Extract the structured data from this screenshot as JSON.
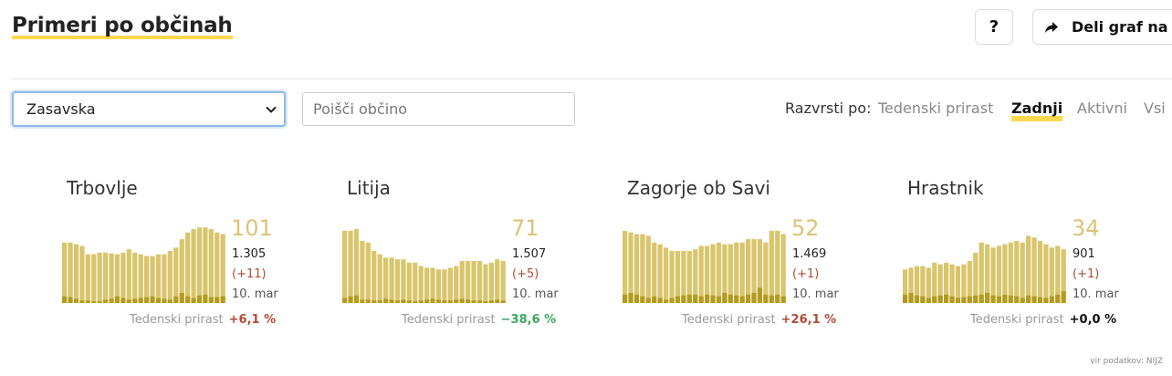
{
  "header": {
    "title": "Primeri po občinah",
    "help_label": "?",
    "share_label": "Deli graf na"
  },
  "filters": {
    "region_selected": "Zasavska",
    "search_placeholder": "Poišči občino",
    "sort_label": "Razvrsti po:",
    "sort_options": [
      "Tedenski prirast",
      "Zadnji",
      "Aktivni",
      "Vsi"
    ],
    "sort_active": "Zadnji"
  },
  "colors": {
    "bar_main": "#d9c56b",
    "bar_low": "#b39b1f",
    "big_number": "#dcc277",
    "negative_trend": "#b04a36",
    "positive_trend": "#3aa85d",
    "accent_underline": "#ffd84d"
  },
  "cards": [
    {
      "name": "Trbovlje",
      "active": "101",
      "total": "1.305",
      "delta": "(+11)",
      "date": "10. mar",
      "weekly_label": "Tedenski prirast",
      "weekly_value": "+6,1 %",
      "weekly_color": "#b04a36",
      "active_series": [
        72,
        72,
        70,
        68,
        58,
        58,
        60,
        60,
        59,
        58,
        60,
        64,
        60,
        58,
        56,
        56,
        58,
        58,
        62,
        66,
        76,
        84,
        88,
        90,
        90,
        88,
        84,
        82
      ],
      "new_series": [
        8,
        7,
        5,
        3,
        3,
        2,
        2,
        4,
        5,
        8,
        6,
        4,
        5,
        6,
        7,
        8,
        6,
        5,
        4,
        8,
        12,
        8,
        6,
        9,
        10,
        7,
        7,
        8
      ]
    },
    {
      "name": "Litija",
      "active": "71",
      "total": "1.507",
      "delta": "(+5)",
      "date": "10. mar",
      "weekly_label": "Tedenski prirast",
      "weekly_value": "−38,6 %",
      "weekly_color": "#3aa85d",
      "active_series": [
        86,
        86,
        88,
        74,
        72,
        62,
        58,
        54,
        54,
        52,
        52,
        48,
        48,
        44,
        42,
        42,
        40,
        40,
        42,
        44,
        50,
        50,
        50,
        50,
        46,
        48,
        52,
        50
      ],
      "new_series": [
        6,
        8,
        9,
        4,
        4,
        3,
        3,
        5,
        4,
        3,
        4,
        3,
        2,
        3,
        4,
        5,
        4,
        3,
        3,
        4,
        5,
        4,
        3,
        3,
        2,
        3,
        4,
        3
      ]
    },
    {
      "name": "Zagorje ob Savi",
      "active": "52",
      "total": "1.469",
      "delta": "(+1)",
      "date": "10. mar",
      "weekly_label": "Tedenski prirast",
      "weekly_value": "+26,1 %",
      "weekly_color": "#b04a36",
      "active_series": [
        86,
        84,
        82,
        82,
        80,
        72,
        70,
        66,
        62,
        62,
        62,
        62,
        64,
        68,
        68,
        70,
        72,
        70,
        70,
        72,
        72,
        76,
        76,
        76,
        72,
        86,
        86,
        82
      ],
      "new_series": [
        10,
        12,
        10,
        8,
        6,
        8,
        6,
        4,
        6,
        8,
        9,
        10,
        10,
        8,
        10,
        9,
        8,
        12,
        10,
        9,
        8,
        10,
        12,
        18,
        10,
        9,
        10,
        8
      ]
    },
    {
      "name": "Hrastnik",
      "active": "34",
      "total": "901",
      "delta": "(+1)",
      "date": "10. mar",
      "weekly_label": "Tedenski prirast",
      "weekly_value": "+0,0 %",
      "weekly_color": "#111111",
      "active_series": [
        40,
        42,
        44,
        44,
        42,
        48,
        46,
        48,
        46,
        44,
        46,
        50,
        60,
        72,
        70,
        66,
        68,
        70,
        72,
        74,
        72,
        80,
        78,
        74,
        70,
        66,
        68,
        64
      ],
      "new_series": [
        10,
        12,
        9,
        8,
        6,
        8,
        9,
        10,
        8,
        6,
        7,
        8,
        9,
        10,
        12,
        9,
        8,
        10,
        9,
        8,
        6,
        9,
        8,
        7,
        6,
        8,
        10,
        14
      ]
    }
  ],
  "footer": {
    "source": "vir podatkov: NIJZ"
  }
}
